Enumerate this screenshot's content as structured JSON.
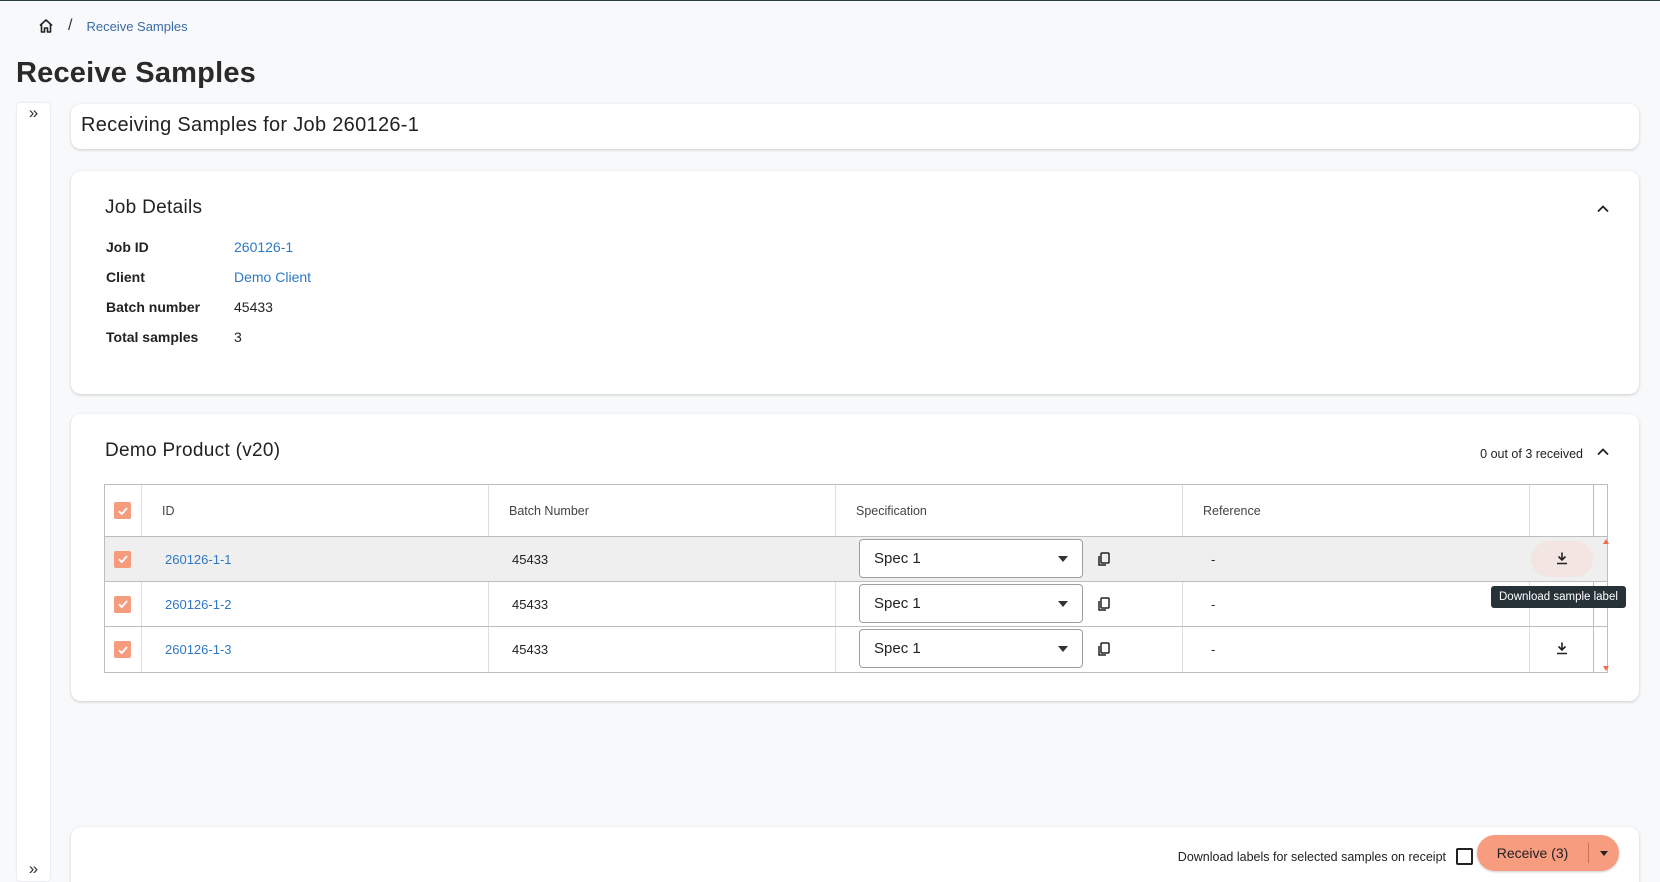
{
  "breadcrumb": {
    "home_icon": "home-icon",
    "separator": "/",
    "current": "Receive Samples"
  },
  "page_title": "Receive Samples",
  "sidebar": {
    "expand_top": "»",
    "expand_bottom": "»"
  },
  "header_card": {
    "title": "Receiving Samples for Job 260126-1"
  },
  "job_details": {
    "title": "Job Details",
    "fields": [
      {
        "label": "Job ID",
        "value": "260126-1"
      },
      {
        "label": "Client",
        "value": "Demo Client"
      },
      {
        "label": "Batch number",
        "value": "45433"
      },
      {
        "label": "Total samples",
        "value": "3"
      }
    ]
  },
  "product": {
    "title": "Demo Product (v20)",
    "received_status": "0 out of 3 received",
    "columns": {
      "id": "ID",
      "batch": "Batch Number",
      "spec": "Specification",
      "reference": "Reference"
    },
    "rows": [
      {
        "id": "260126-1-1",
        "batch": "45433",
        "spec": "Spec 1",
        "reference": "-",
        "checked": true
      },
      {
        "id": "260126-1-2",
        "batch": "45433",
        "spec": "Spec 1",
        "reference": "-",
        "checked": true
      },
      {
        "id": "260126-1-3",
        "batch": "45433",
        "spec": "Spec 1",
        "reference": "-",
        "checked": true
      }
    ]
  },
  "tooltip": "Download sample label",
  "footer": {
    "download_option_label": "Download labels for selected samples on receipt",
    "receive_button": "Receive (3)"
  },
  "colors": {
    "accent": "#f89c80",
    "checkbox": "#f59b7e",
    "link": "#2f78c4",
    "tooltip_bg": "#263238"
  }
}
